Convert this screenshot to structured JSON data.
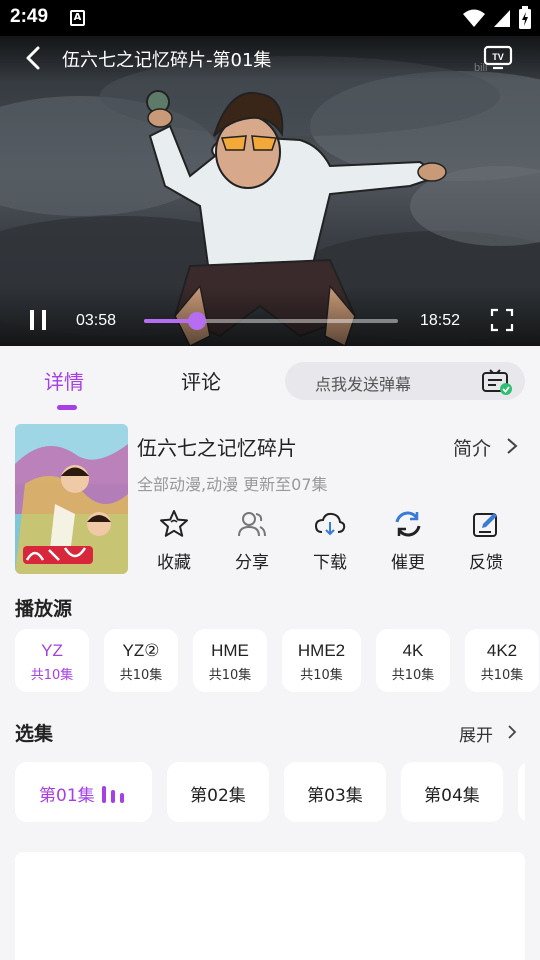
{
  "status_bar": {
    "time": "2:49",
    "notification_glyph": "A"
  },
  "player": {
    "title": "伍六七之记忆碎片-第01集",
    "watermark": "bili",
    "current_time": "03:58",
    "total_time": "18:52",
    "progress": 0.21,
    "state": "playing"
  },
  "tabs": [
    {
      "label": "详情",
      "active": true
    },
    {
      "label": "评论",
      "active": false
    }
  ],
  "danmaku": {
    "placeholder": "点我发送弹幕"
  },
  "anime": {
    "title": "伍六七之记忆碎片",
    "intro_label": "简介",
    "meta": "全部动漫,动漫 更新至07集"
  },
  "actions": [
    {
      "label": "收藏",
      "icon": "star-icon"
    },
    {
      "label": "分享",
      "icon": "share-users-icon"
    },
    {
      "label": "下载",
      "icon": "cloud-download-icon"
    },
    {
      "label": "催更",
      "icon": "refresh-icon"
    },
    {
      "label": "反馈",
      "icon": "feedback-edit-icon"
    }
  ],
  "sources_title": "播放源",
  "sources": [
    {
      "name": "YZ",
      "count": "共10集",
      "active": true
    },
    {
      "name": "YZ②",
      "count": "共10集",
      "active": false
    },
    {
      "name": "HME",
      "count": "共10集",
      "active": false
    },
    {
      "name": "HME2",
      "count": "共10集",
      "active": false
    },
    {
      "name": "4K",
      "count": "共10集",
      "active": false
    },
    {
      "name": "4K2",
      "count": "共10集",
      "active": false
    }
  ],
  "episodes_title": "选集",
  "expand_label": "展开",
  "episodes": [
    {
      "label": "第01集",
      "active": true
    },
    {
      "label": "第02集",
      "active": false
    },
    {
      "label": "第03集",
      "active": false
    },
    {
      "label": "第04集",
      "active": false
    },
    {
      "label": "",
      "active": false
    }
  ],
  "colors": {
    "accent": "#a640e6",
    "seek": "#b66df2",
    "background": "#f5f5f7",
    "card": "#ffffff"
  }
}
